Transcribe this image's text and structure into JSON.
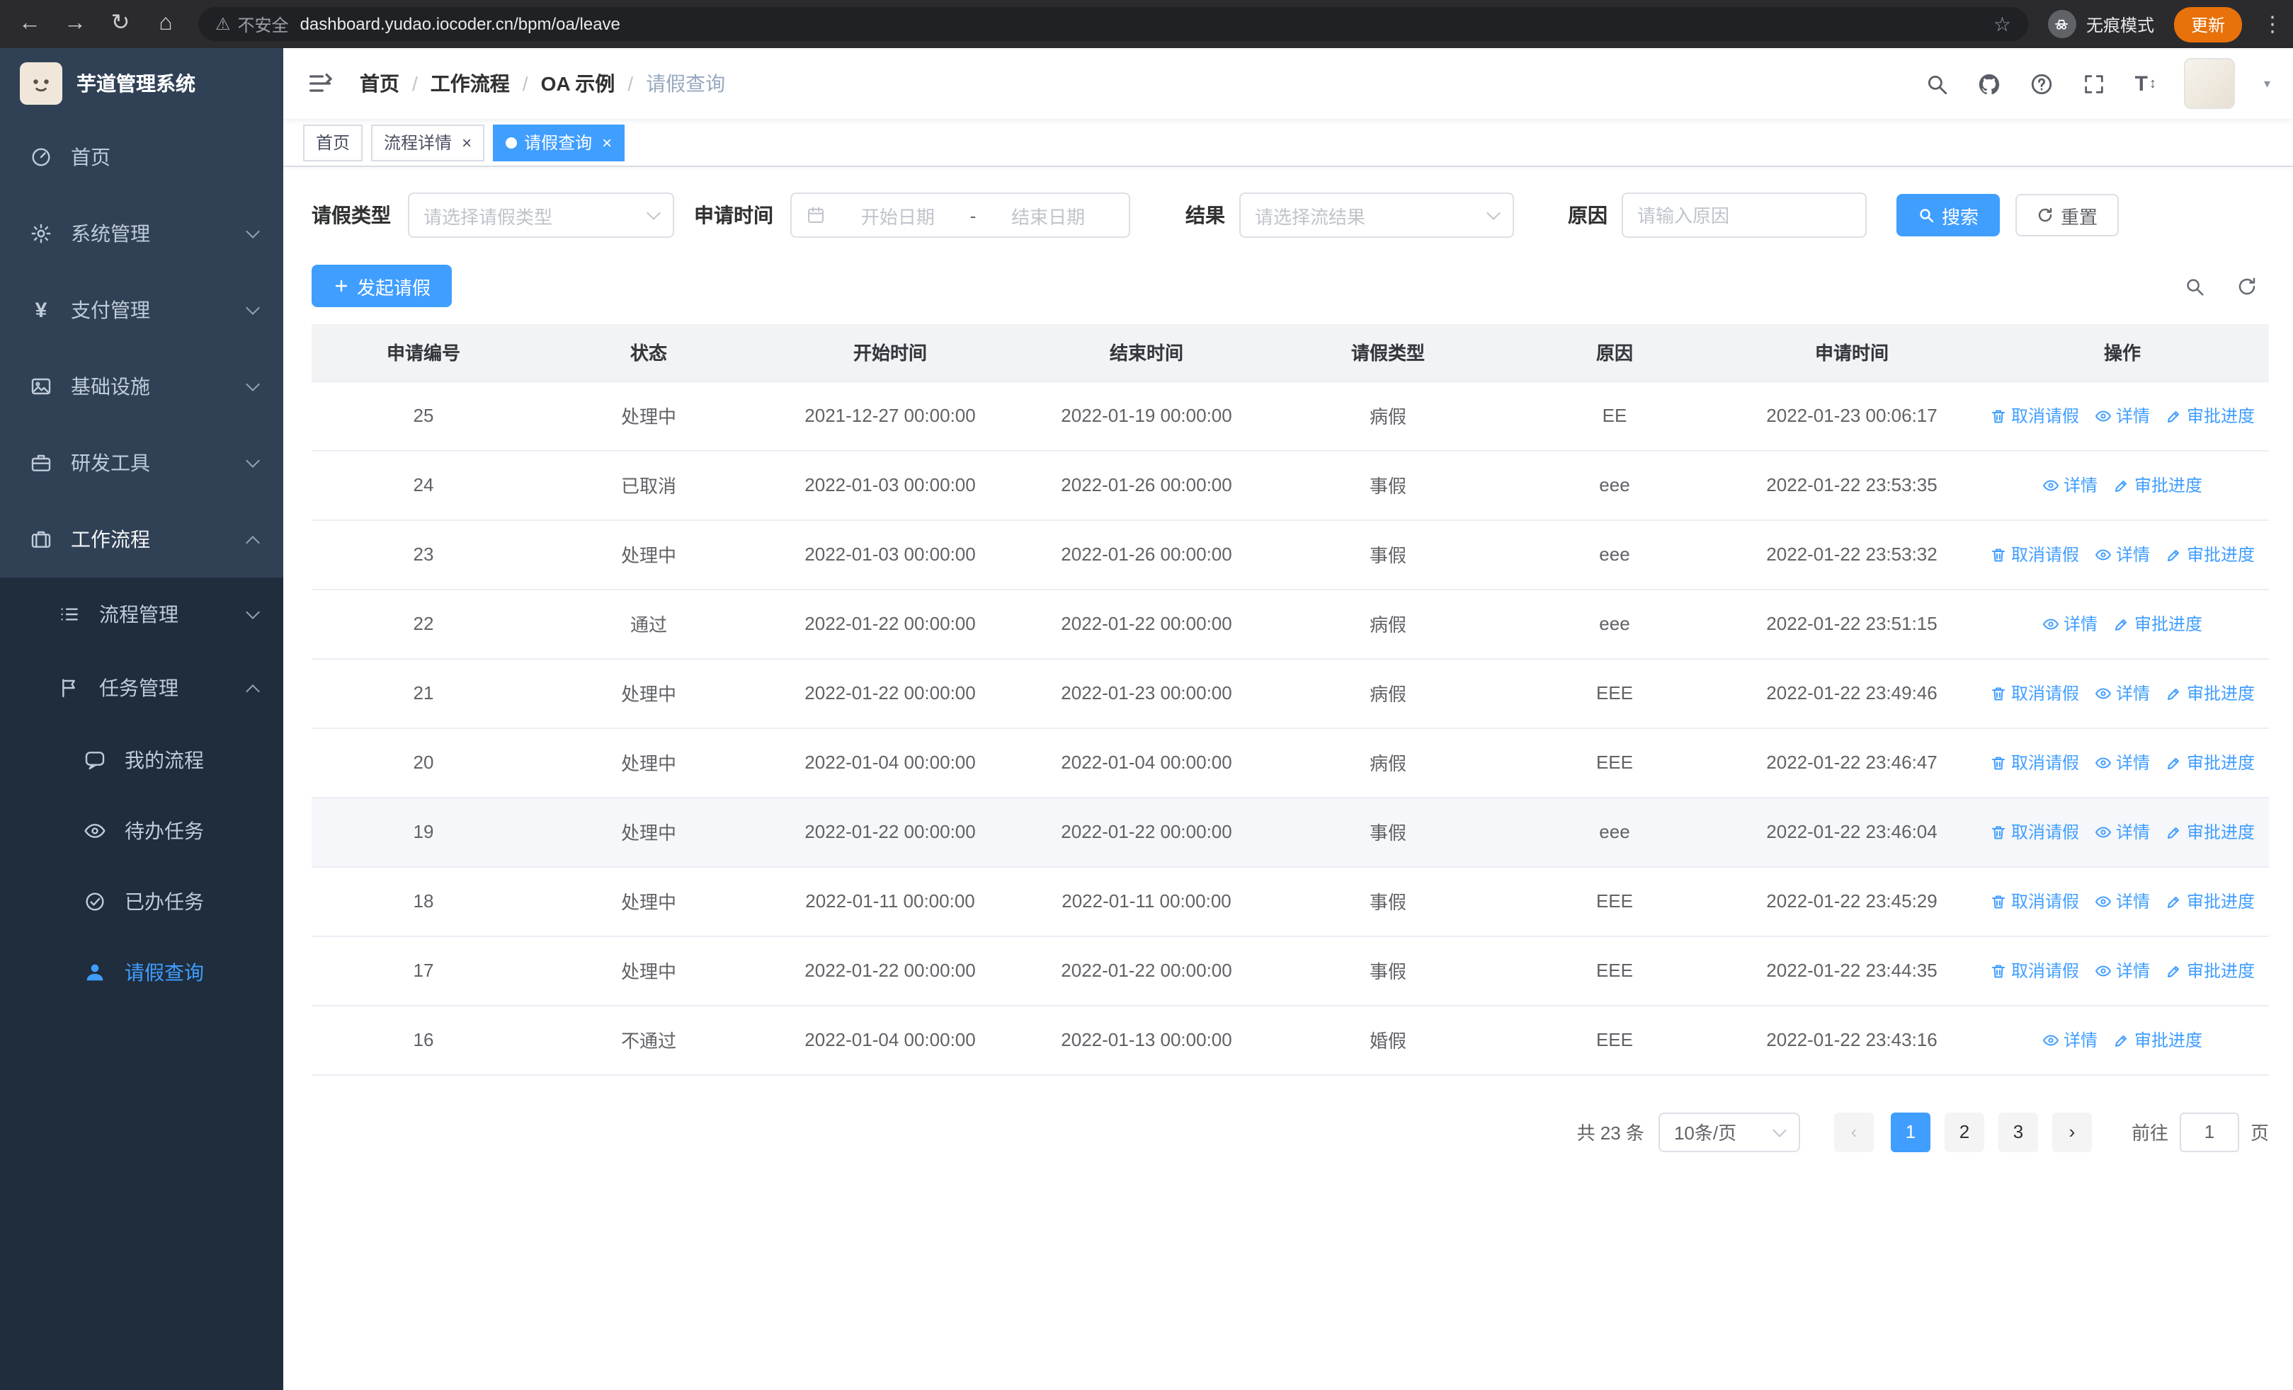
{
  "browser": {
    "security_label": "不安全",
    "url": "dashboard.yudao.iocoder.cn/bpm/oa/leave",
    "incognito_label": "无痕模式",
    "update_label": "更新"
  },
  "sidebar": {
    "app_title": "芋道管理系统",
    "items": [
      {
        "label": "首页"
      },
      {
        "label": "系统管理"
      },
      {
        "label": "支付管理"
      },
      {
        "label": "基础设施"
      },
      {
        "label": "研发工具"
      },
      {
        "label": "工作流程",
        "children": [
          {
            "label": "流程管理"
          },
          {
            "label": "任务管理",
            "children": [
              {
                "label": "我的流程"
              },
              {
                "label": "待办任务"
              },
              {
                "label": "已办任务"
              },
              {
                "label": "请假查询",
                "active": true
              }
            ]
          }
        ]
      }
    ]
  },
  "header": {
    "breadcrumb": [
      "首页",
      "工作流程",
      "OA 示例",
      "请假查询"
    ],
    "separator": "/"
  },
  "tabs": [
    {
      "label": "首页",
      "closable": false,
      "active": false
    },
    {
      "label": "流程详情",
      "closable": true,
      "active": false
    },
    {
      "label": "请假查询",
      "closable": true,
      "active": true
    }
  ],
  "filters": {
    "leave_type_label": "请假类型",
    "leave_type_placeholder": "请选择请假类型",
    "apply_time_label": "申请时间",
    "start_date_placeholder": "开始日期",
    "range_separator": "-",
    "end_date_placeholder": "结束日期",
    "result_label": "结果",
    "result_placeholder": "请选择流结果",
    "reason_label": "原因",
    "reason_placeholder": "请输入原因",
    "search_label": "搜索",
    "reset_label": "重置"
  },
  "toolbar": {
    "create_label": "发起请假"
  },
  "table": {
    "columns": [
      "申请编号",
      "状态",
      "开始时间",
      "结束时间",
      "请假类型",
      "原因",
      "申请时间",
      "操作"
    ],
    "action_labels": {
      "cancel": "取消请假",
      "detail": "详情",
      "progress": "审批进度"
    },
    "rows": [
      {
        "id": "25",
        "status": "处理中",
        "start_time": "2021-12-27 00:00:00",
        "end_time": "2022-01-19 00:00:00",
        "leave_type": "病假",
        "reason": "EE",
        "apply_time": "2022-01-23 00:06:17",
        "actions": [
          "cancel",
          "detail",
          "progress"
        ]
      },
      {
        "id": "24",
        "status": "已取消",
        "start_time": "2022-01-03 00:00:00",
        "end_time": "2022-01-26 00:00:00",
        "leave_type": "事假",
        "reason": "eee",
        "apply_time": "2022-01-22 23:53:35",
        "actions": [
          "detail",
          "progress"
        ]
      },
      {
        "id": "23",
        "status": "处理中",
        "start_time": "2022-01-03 00:00:00",
        "end_time": "2022-01-26 00:00:00",
        "leave_type": "事假",
        "reason": "eee",
        "apply_time": "2022-01-22 23:53:32",
        "actions": [
          "cancel",
          "detail",
          "progress"
        ]
      },
      {
        "id": "22",
        "status": "通过",
        "start_time": "2022-01-22 00:00:00",
        "end_time": "2022-01-22 00:00:00",
        "leave_type": "病假",
        "reason": "eee",
        "apply_time": "2022-01-22 23:51:15",
        "actions": [
          "detail",
          "progress"
        ]
      },
      {
        "id": "21",
        "status": "处理中",
        "start_time": "2022-01-22 00:00:00",
        "end_time": "2022-01-23 00:00:00",
        "leave_type": "病假",
        "reason": "EEE",
        "apply_time": "2022-01-22 23:49:46",
        "actions": [
          "cancel",
          "detail",
          "progress"
        ]
      },
      {
        "id": "20",
        "status": "处理中",
        "start_time": "2022-01-04 00:00:00",
        "end_time": "2022-01-04 00:00:00",
        "leave_type": "病假",
        "reason": "EEE",
        "apply_time": "2022-01-22 23:46:47",
        "actions": [
          "cancel",
          "detail",
          "progress"
        ]
      },
      {
        "id": "19",
        "status": "处理中",
        "start_time": "2022-01-22 00:00:00",
        "end_time": "2022-01-22 00:00:00",
        "leave_type": "事假",
        "reason": "eee",
        "apply_time": "2022-01-22 23:46:04",
        "actions": [
          "cancel",
          "detail",
          "progress"
        ]
      },
      {
        "id": "18",
        "status": "处理中",
        "start_time": "2022-01-11 00:00:00",
        "end_time": "2022-01-11 00:00:00",
        "leave_type": "事假",
        "reason": "EEE",
        "apply_time": "2022-01-22 23:45:29",
        "actions": [
          "cancel",
          "detail",
          "progress"
        ]
      },
      {
        "id": "17",
        "status": "处理中",
        "start_time": "2022-01-22 00:00:00",
        "end_time": "2022-01-22 00:00:00",
        "leave_type": "事假",
        "reason": "EEE",
        "apply_time": "2022-01-22 23:44:35",
        "actions": [
          "cancel",
          "detail",
          "progress"
        ]
      },
      {
        "id": "16",
        "status": "不通过",
        "start_time": "2022-01-04 00:00:00",
        "end_time": "2022-01-13 00:00:00",
        "leave_type": "婚假",
        "reason": "EEE",
        "apply_time": "2022-01-22 23:43:16",
        "actions": [
          "detail",
          "progress"
        ]
      }
    ]
  },
  "pagination": {
    "total_label": "共 23 条",
    "page_size_label": "10条/页",
    "pages": [
      "1",
      "2",
      "3"
    ],
    "active_page": "1",
    "goto_prefix": "前往",
    "goto_value": "1",
    "goto_suffix": "页"
  },
  "colors": {
    "primary": "#409eff",
    "sidebar_bg": "#304156",
    "submenu_bg": "#1f2d3d",
    "chrome_bg": "#2b2b2e",
    "update_badge": "#e8710a",
    "table_header_bg": "#f2f3f5"
  }
}
